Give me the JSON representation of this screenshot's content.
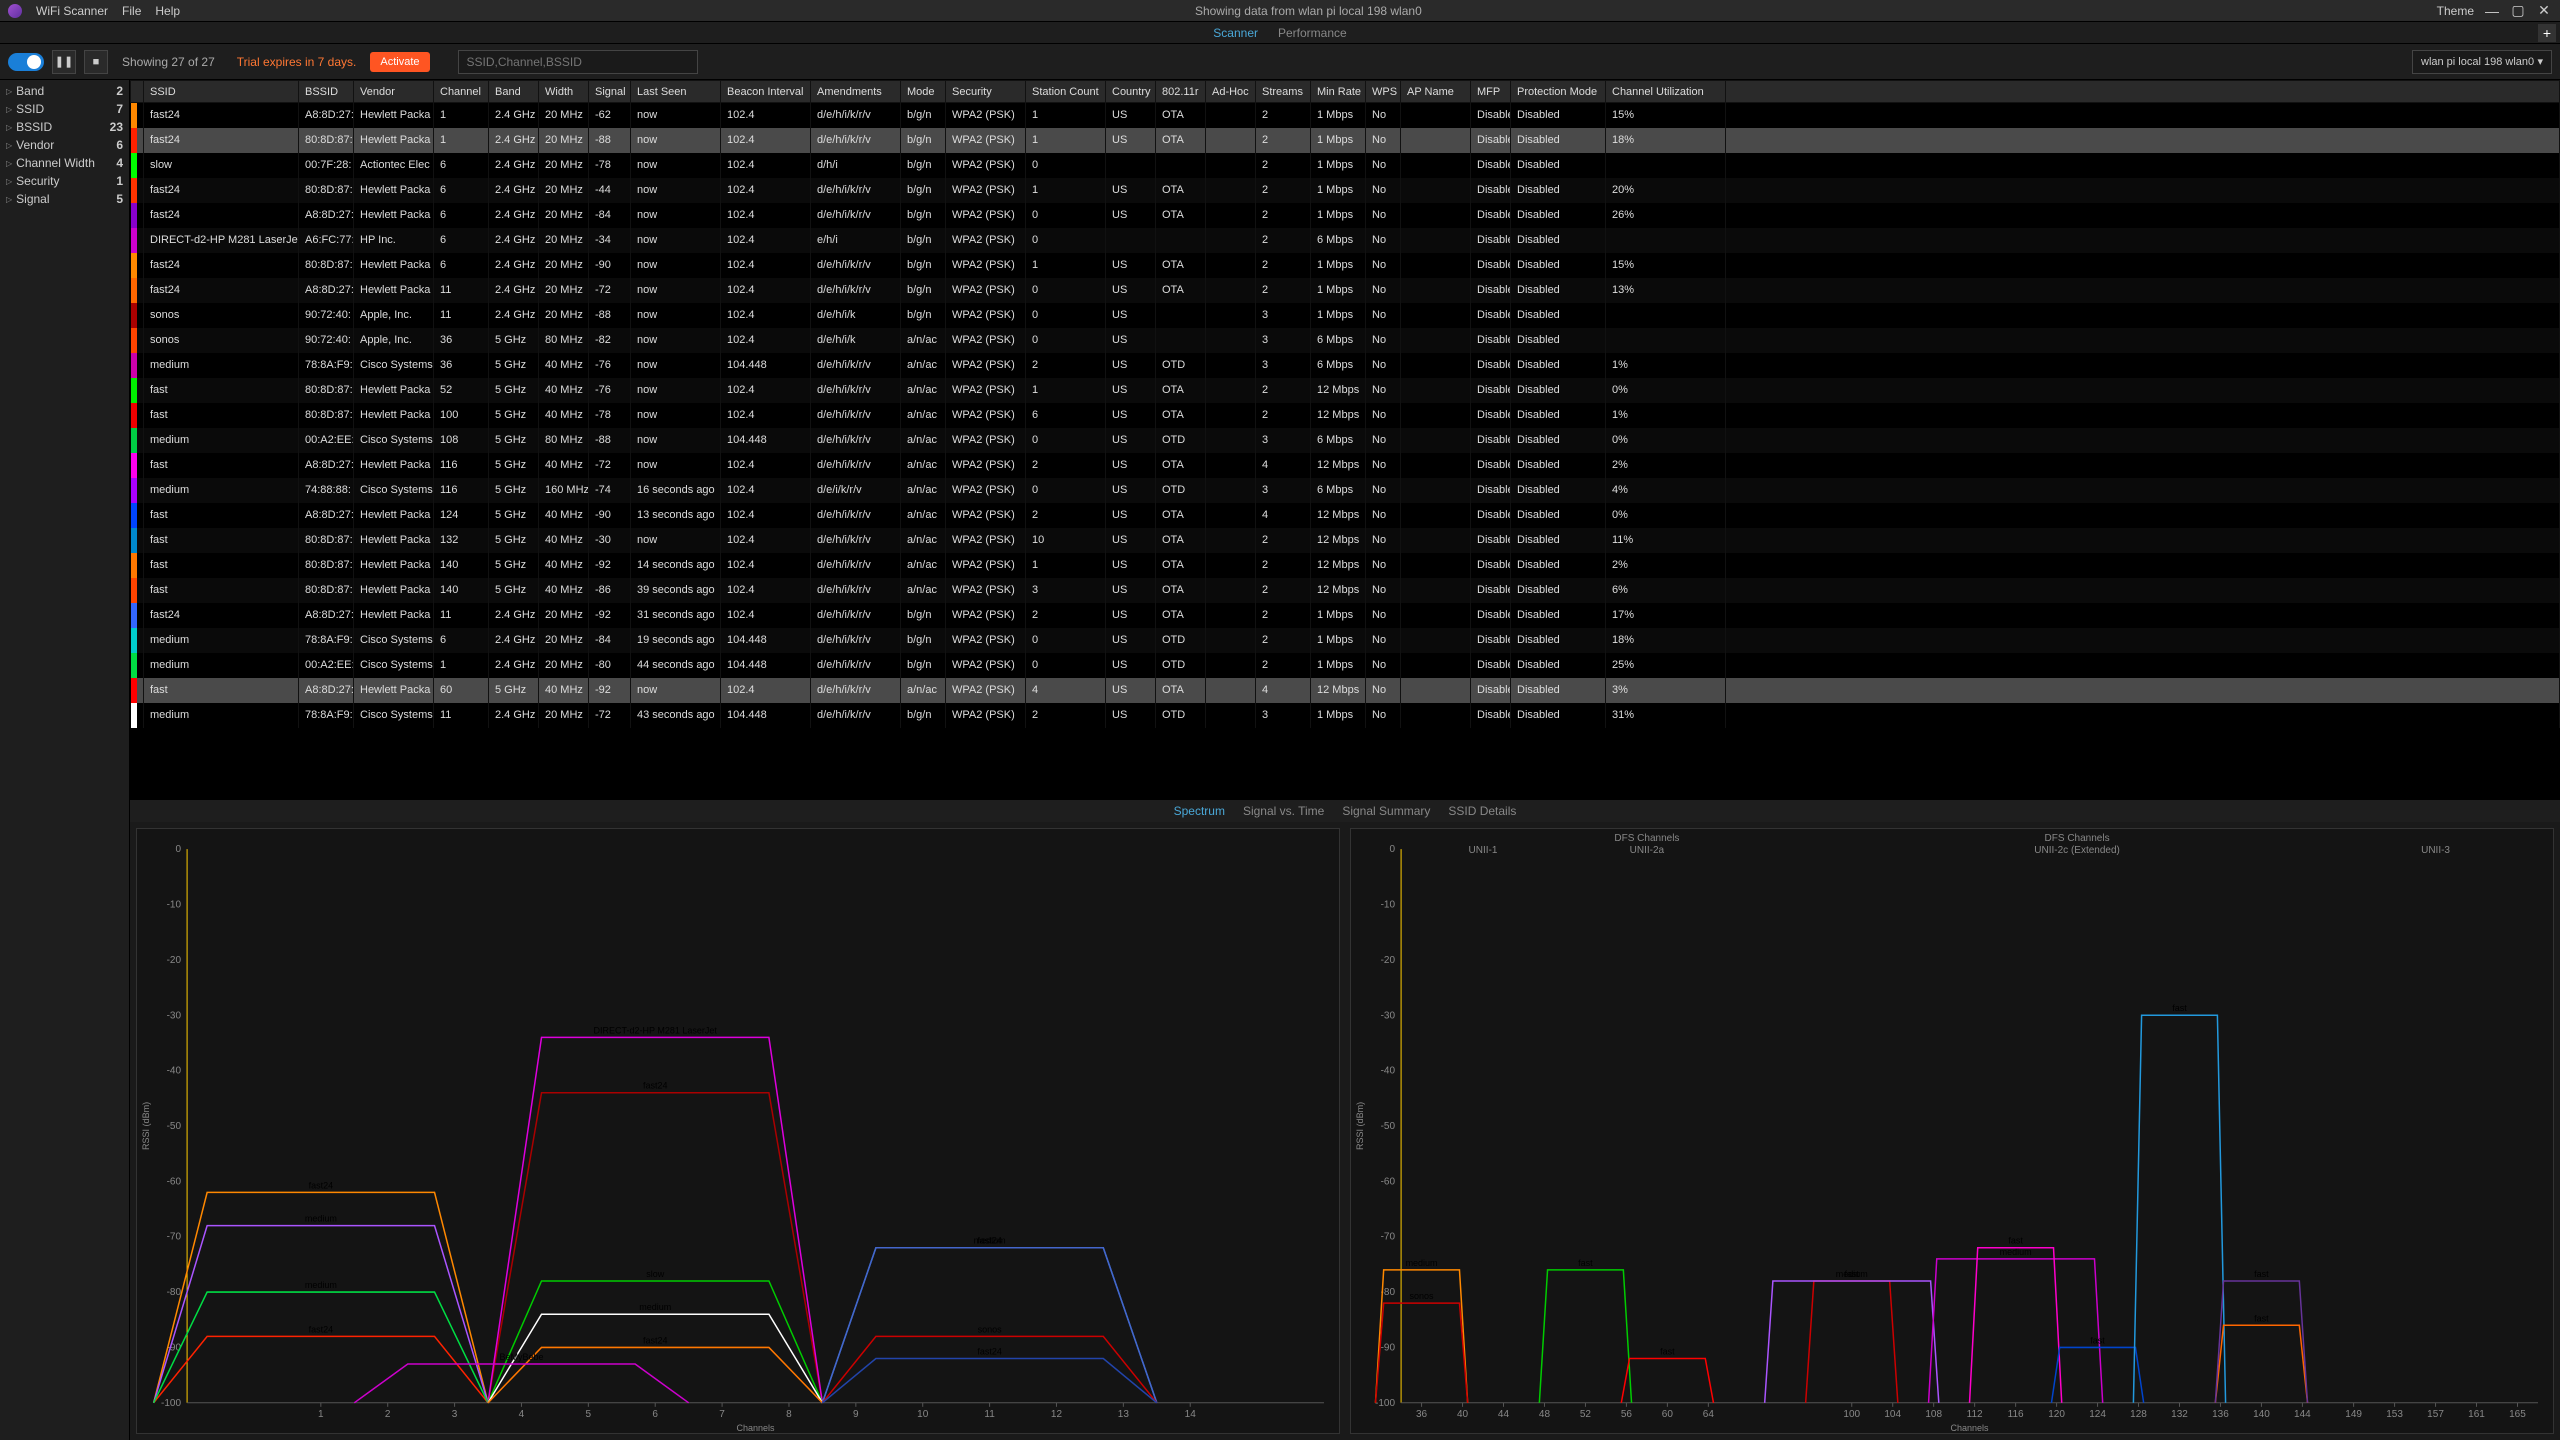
{
  "titlebar": {
    "app": "WiFi Scanner",
    "menu": [
      "File",
      "Help"
    ],
    "status": "Showing data from wlan pi local 198 wlan0",
    "theme": "Theme"
  },
  "subtabs": {
    "scanner": "Scanner",
    "performance": "Performance"
  },
  "toolbar": {
    "showing": "Showing 27 of 27",
    "trial": "Trial expires in 7 days.",
    "activate": "Activate",
    "search_placeholder": "SSID,Channel,BSSID",
    "iface": "wlan pi local 198 wlan0"
  },
  "filters": [
    {
      "label": "Band",
      "count": 2
    },
    {
      "label": "SSID",
      "count": 7
    },
    {
      "label": "BSSID",
      "count": 23
    },
    {
      "label": "Vendor",
      "count": 6
    },
    {
      "label": "Channel Width",
      "count": 4
    },
    {
      "label": "Security",
      "count": 1
    },
    {
      "label": "Signal",
      "count": 5
    }
  ],
  "columns": [
    "SSID",
    "BSSID",
    "Vendor",
    "Channel",
    "Band",
    "Width",
    "Signal",
    "Last Seen",
    "Beacon Interval",
    "Amendments",
    "Mode",
    "Security",
    "Station Count",
    "Country",
    "802.11r",
    "Ad-Hoc",
    "Streams",
    "Min Rate",
    "WPS",
    "AP Name",
    "MFP",
    "Protection Mode",
    "Channel Utilization"
  ],
  "rows": [
    {
      "c": "#ff8800",
      "sel": false,
      "d": [
        "fast24",
        "A8:8D:27:",
        "Hewlett Packa",
        "1",
        "2.4 GHz",
        "20 MHz",
        "-62",
        "now",
        "102.4",
        "d/e/h/i/k/r/v",
        "b/g/n",
        "WPA2 (PSK)",
        "1",
        "US",
        "OTA",
        "",
        "2",
        "1 Mbps",
        "No",
        "",
        "Disabled",
        "Disabled",
        "15%"
      ]
    },
    {
      "c": "#ff2200",
      "sel": true,
      "d": [
        "fast24",
        "80:8D:87:",
        "Hewlett Packa",
        "1",
        "2.4 GHz",
        "20 MHz",
        "-88",
        "now",
        "102.4",
        "d/e/h/i/k/r/v",
        "b/g/n",
        "WPA2 (PSK)",
        "1",
        "US",
        "OTA",
        "",
        "2",
        "1 Mbps",
        "No",
        "",
        "Disabled",
        "Disabled",
        "18%"
      ]
    },
    {
      "c": "#00ff00",
      "sel": false,
      "d": [
        "slow",
        "00:7F:28:",
        "Actiontec Elec",
        "6",
        "2.4 GHz",
        "20 MHz",
        "-78",
        "now",
        "102.4",
        "d/h/i",
        "b/g/n",
        "WPA2 (PSK)",
        "0",
        "",
        "",
        "",
        "2",
        "1 Mbps",
        "No",
        "",
        "Disabled",
        "Disabled",
        ""
      ]
    },
    {
      "c": "#ff3300",
      "sel": false,
      "d": [
        "fast24",
        "80:8D:87:",
        "Hewlett Packa",
        "6",
        "2.4 GHz",
        "20 MHz",
        "-44",
        "now",
        "102.4",
        "d/e/h/i/k/r/v",
        "b/g/n",
        "WPA2 (PSK)",
        "1",
        "US",
        "OTA",
        "",
        "2",
        "1 Mbps",
        "No",
        "",
        "Disabled",
        "Disabled",
        "20%"
      ]
    },
    {
      "c": "#8800cc",
      "sel": false,
      "d": [
        "fast24",
        "A8:8D:27:",
        "Hewlett Packa",
        "6",
        "2.4 GHz",
        "20 MHz",
        "-84",
        "now",
        "102.4",
        "d/e/h/i/k/r/v",
        "b/g/n",
        "WPA2 (PSK)",
        "0",
        "US",
        "OTA",
        "",
        "2",
        "1 Mbps",
        "No",
        "",
        "Disabled",
        "Disabled",
        "26%"
      ]
    },
    {
      "c": "#cc00cc",
      "sel": false,
      "d": [
        "DIRECT-d2-HP M281 LaserJet",
        "A6:FC:77:",
        "HP Inc.",
        "6",
        "2.4 GHz",
        "20 MHz",
        "-34",
        "now",
        "102.4",
        "e/h/i",
        "b/g/n",
        "WPA2 (PSK)",
        "0",
        "",
        "",
        "",
        "2",
        "6 Mbps",
        "No",
        "",
        "Disabled",
        "Disabled",
        ""
      ]
    },
    {
      "c": "#ff8800",
      "sel": false,
      "d": [
        "fast24",
        "80:8D:87:",
        "Hewlett Packa",
        "6",
        "2.4 GHz",
        "20 MHz",
        "-90",
        "now",
        "102.4",
        "d/e/h/i/k/r/v",
        "b/g/n",
        "WPA2 (PSK)",
        "1",
        "US",
        "OTA",
        "",
        "2",
        "1 Mbps",
        "No",
        "",
        "Disabled",
        "Disabled",
        "15%"
      ]
    },
    {
      "c": "#ff6600",
      "sel": false,
      "d": [
        "fast24",
        "A8:8D:27:",
        "Hewlett Packa",
        "11",
        "2.4 GHz",
        "20 MHz",
        "-72",
        "now",
        "102.4",
        "d/e/h/i/k/r/v",
        "b/g/n",
        "WPA2 (PSK)",
        "0",
        "US",
        "OTA",
        "",
        "2",
        "1 Mbps",
        "No",
        "",
        "Disabled",
        "Disabled",
        "13%"
      ]
    },
    {
      "c": "#aa0000",
      "sel": false,
      "d": [
        "sonos",
        "90:72:40:",
        "Apple, Inc.",
        "11",
        "2.4 GHz",
        "20 MHz",
        "-88",
        "now",
        "102.4",
        "d/e/h/i/k",
        "b/g/n",
        "WPA2 (PSK)",
        "0",
        "US",
        "",
        "",
        "3",
        "1 Mbps",
        "No",
        "",
        "Disabled",
        "Disabled",
        ""
      ]
    },
    {
      "c": "#ff4400",
      "sel": false,
      "d": [
        "sonos",
        "90:72:40:",
        "Apple, Inc.",
        "36",
        "5 GHz",
        "80 MHz",
        "-82",
        "now",
        "102.4",
        "d/e/h/i/k",
        "a/n/ac",
        "WPA2 (PSK)",
        "0",
        "US",
        "",
        "",
        "3",
        "6 Mbps",
        "No",
        "",
        "Disabled",
        "Disabled",
        ""
      ]
    },
    {
      "c": "#cc00aa",
      "sel": false,
      "d": [
        "medium",
        "78:8A:F9:",
        "Cisco Systems,",
        "36",
        "5 GHz",
        "40 MHz",
        "-76",
        "now",
        "104.448",
        "d/e/h/i/k/r/v",
        "a/n/ac",
        "WPA2 (PSK)",
        "2",
        "US",
        "OTD",
        "",
        "3",
        "6 Mbps",
        "No",
        "",
        "Disabled",
        "Disabled",
        "1%"
      ]
    },
    {
      "c": "#00ee00",
      "sel": false,
      "d": [
        "fast",
        "80:8D:87:",
        "Hewlett Packa",
        "52",
        "5 GHz",
        "40 MHz",
        "-76",
        "now",
        "102.4",
        "d/e/h/i/k/r/v",
        "a/n/ac",
        "WPA2 (PSK)",
        "1",
        "US",
        "OTA",
        "",
        "2",
        "12 Mbps",
        "No",
        "",
        "Disabled",
        "Disabled",
        "0%"
      ]
    },
    {
      "c": "#ee0000",
      "sel": false,
      "d": [
        "fast",
        "80:8D:87:",
        "Hewlett Packa",
        "100",
        "5 GHz",
        "40 MHz",
        "-78",
        "now",
        "102.4",
        "d/e/h/i/k/r/v",
        "a/n/ac",
        "WPA2 (PSK)",
        "6",
        "US",
        "OTA",
        "",
        "2",
        "12 Mbps",
        "No",
        "",
        "Disabled",
        "Disabled",
        "1%"
      ]
    },
    {
      "c": "#00cc44",
      "sel": false,
      "d": [
        "medium",
        "00:A2:EE:",
        "Cisco Systems,",
        "108",
        "5 GHz",
        "80 MHz",
        "-88",
        "now",
        "104.448",
        "d/e/h/i/k/r/v",
        "a/n/ac",
        "WPA2 (PSK)",
        "0",
        "US",
        "OTD",
        "",
        "3",
        "6 Mbps",
        "No",
        "",
        "Disabled",
        "Disabled",
        "0%"
      ]
    },
    {
      "c": "#ff00ee",
      "sel": false,
      "d": [
        "fast",
        "A8:8D:27:",
        "Hewlett Packa",
        "116",
        "5 GHz",
        "40 MHz",
        "-72",
        "now",
        "102.4",
        "d/e/h/i/k/r/v",
        "a/n/ac",
        "WPA2 (PSK)",
        "2",
        "US",
        "OTA",
        "",
        "4",
        "12 Mbps",
        "No",
        "",
        "Disabled",
        "Disabled",
        "2%"
      ]
    },
    {
      "c": "#aa00ff",
      "sel": false,
      "d": [
        "medium",
        "74:88:88:",
        "Cisco Systems,",
        "116",
        "5 GHz",
        "160 MHz",
        "-74",
        "16 seconds ago",
        "102.4",
        "d/e/i/k/r/v",
        "a/n/ac",
        "WPA2 (PSK)",
        "0",
        "US",
        "OTD",
        "",
        "3",
        "6 Mbps",
        "No",
        "",
        "Disabled",
        "Disabled",
        "4%"
      ]
    },
    {
      "c": "#0044ff",
      "sel": false,
      "d": [
        "fast",
        "A8:8D:27:",
        "Hewlett Packa",
        "124",
        "5 GHz",
        "40 MHz",
        "-90",
        "13 seconds ago",
        "102.4",
        "d/e/h/i/k/r/v",
        "a/n/ac",
        "WPA2 (PSK)",
        "2",
        "US",
        "OTA",
        "",
        "4",
        "12 Mbps",
        "No",
        "",
        "Disabled",
        "Disabled",
        "0%"
      ]
    },
    {
      "c": "#0088cc",
      "sel": false,
      "d": [
        "fast",
        "80:8D:87:",
        "Hewlett Packa",
        "132",
        "5 GHz",
        "40 MHz",
        "-30",
        "now",
        "102.4",
        "d/e/h/i/k/r/v",
        "a/n/ac",
        "WPA2 (PSK)",
        "10",
        "US",
        "OTA",
        "",
        "2",
        "12 Mbps",
        "No",
        "",
        "Disabled",
        "Disabled",
        "11%"
      ]
    },
    {
      "c": "#ff7700",
      "sel": false,
      "d": [
        "fast",
        "80:8D:87:",
        "Hewlett Packa",
        "140",
        "5 GHz",
        "40 MHz",
        "-92",
        "14 seconds ago",
        "102.4",
        "d/e/h/i/k/r/v",
        "a/n/ac",
        "WPA2 (PSK)",
        "1",
        "US",
        "OTA",
        "",
        "2",
        "12 Mbps",
        "No",
        "",
        "Disabled",
        "Disabled",
        "2%"
      ]
    },
    {
      "c": "#ff4400",
      "sel": false,
      "d": [
        "fast",
        "80:8D:87:",
        "Hewlett Packa",
        "140",
        "5 GHz",
        "40 MHz",
        "-86",
        "39 seconds ago",
        "102.4",
        "d/e/h/i/k/r/v",
        "a/n/ac",
        "WPA2 (PSK)",
        "3",
        "US",
        "OTA",
        "",
        "2",
        "12 Mbps",
        "No",
        "",
        "Disabled",
        "Disabled",
        "6%"
      ]
    },
    {
      "c": "#3366ff",
      "sel": false,
      "d": [
        "fast24",
        "A8:8D:27:",
        "Hewlett Packa",
        "11",
        "2.4 GHz",
        "20 MHz",
        "-92",
        "31 seconds ago",
        "102.4",
        "d/e/h/i/k/r/v",
        "b/g/n",
        "WPA2 (PSK)",
        "2",
        "US",
        "OTA",
        "",
        "2",
        "1 Mbps",
        "No",
        "",
        "Disabled",
        "Disabled",
        "17%"
      ]
    },
    {
      "c": "#00cccc",
      "sel": false,
      "d": [
        "medium",
        "78:8A:F9:",
        "Cisco Systems,",
        "6",
        "2.4 GHz",
        "20 MHz",
        "-84",
        "19 seconds ago",
        "104.448",
        "d/e/h/i/k/r/v",
        "b/g/n",
        "WPA2 (PSK)",
        "0",
        "US",
        "OTD",
        "",
        "2",
        "1 Mbps",
        "No",
        "",
        "Disabled",
        "Disabled",
        "18%"
      ]
    },
    {
      "c": "#00dd44",
      "sel": false,
      "d": [
        "medium",
        "00:A2:EE:",
        "Cisco Systems,",
        "1",
        "2.4 GHz",
        "20 MHz",
        "-80",
        "44 seconds ago",
        "104.448",
        "d/e/h/i/k/r/v",
        "b/g/n",
        "WPA2 (PSK)",
        "0",
        "US",
        "OTD",
        "",
        "2",
        "1 Mbps",
        "No",
        "",
        "Disabled",
        "Disabled",
        "25%"
      ]
    },
    {
      "c": "#ff0000",
      "sel": true,
      "d": [
        "fast",
        "A8:8D:27:",
        "Hewlett Packa",
        "60",
        "5 GHz",
        "40 MHz",
        "-92",
        "now",
        "102.4",
        "d/e/h/i/k/r/v",
        "a/n/ac",
        "WPA2 (PSK)",
        "4",
        "US",
        "OTA",
        "",
        "4",
        "12 Mbps",
        "No",
        "",
        "Disabled",
        "Disabled",
        "3%"
      ]
    },
    {
      "c": "#ffffff",
      "sel": false,
      "d": [
        "medium",
        "78:8A:F9:",
        "Cisco Systems,",
        "11",
        "2.4 GHz",
        "20 MHz",
        "-72",
        "43 seconds ago",
        "104.448",
        "d/e/h/i/k/r/v",
        "b/g/n",
        "WPA2 (PSK)",
        "2",
        "US",
        "OTD",
        "",
        "3",
        "1 Mbps",
        "No",
        "",
        "Disabled",
        "Disabled",
        "31%"
      ]
    }
  ],
  "bottomTabs": [
    "Spectrum",
    "Signal vs. Time",
    "Signal Summary",
    "SSID Details"
  ],
  "chart_data": [
    {
      "type": "spectrum",
      "xlabel": "Channels",
      "ylabel": "RSSI (dBm)",
      "ylim": [
        -100,
        0
      ],
      "xticks": [
        1,
        2,
        3,
        4,
        5,
        6,
        7,
        8,
        9,
        10,
        11,
        12,
        13,
        14
      ],
      "networks": [
        {
          "name": "fast24",
          "ch": 1,
          "width": 20,
          "rssi": -62,
          "color": "#ff8800"
        },
        {
          "name": "fast24",
          "ch": 1,
          "width": 20,
          "rssi": -88,
          "color": "#ff2200"
        },
        {
          "name": "medium",
          "ch": 1,
          "width": 20,
          "rssi": -68,
          "color": "#aa55ff"
        },
        {
          "name": "medium",
          "ch": 1,
          "width": 20,
          "rssi": -80,
          "color": "#00dd44"
        },
        {
          "name": "fast24",
          "ch": 6,
          "width": 20,
          "rssi": -44,
          "color": "#aa0000"
        },
        {
          "name": "DIRECT-d2-HP M281 LaserJet",
          "ch": 6,
          "width": 20,
          "rssi": -34,
          "color": "#dd00dd"
        },
        {
          "name": "slow",
          "ch": 6,
          "width": 20,
          "rssi": -78,
          "color": "#00cc00"
        },
        {
          "name": "medium",
          "ch": 6,
          "width": 20,
          "rssi": -84,
          "color": "#ffffff"
        },
        {
          "name": "fast24",
          "ch": 6,
          "width": 20,
          "rssi": -90,
          "color": "#ff7700"
        },
        {
          "name": "BeMyBebe",
          "ch": 4,
          "width": 20,
          "rssi": -93,
          "color": "#cc00cc"
        },
        {
          "name": "fast24",
          "ch": 11,
          "width": 20,
          "rssi": -72,
          "color": "#3388dd"
        },
        {
          "name": "medium",
          "ch": 11,
          "width": 20,
          "rssi": -72,
          "color": "#4466cc"
        },
        {
          "name": "sonos",
          "ch": 11,
          "width": 20,
          "rssi": -88,
          "color": "#cc0000"
        },
        {
          "name": "fast24",
          "ch": 11,
          "width": 20,
          "rssi": -92,
          "color": "#2244aa"
        }
      ]
    },
    {
      "type": "spectrum",
      "xlabel": "Channels",
      "ylabel": "RSSI (dBm)",
      "ylim": [
        -100,
        0
      ],
      "xticks": [
        36,
        40,
        44,
        48,
        52,
        56,
        60,
        64,
        100,
        104,
        108,
        112,
        116,
        120,
        124,
        128,
        132,
        136,
        140,
        144,
        149,
        153,
        157,
        161,
        165
      ],
      "bands": [
        {
          "label": "UNII-1",
          "sub": "",
          "start": 36,
          "end": 48
        },
        {
          "label": "DFS Channels",
          "sub": "UNII-2a",
          "start": 52,
          "end": 64
        },
        {
          "label": "DFS Channels",
          "sub": "UNII-2c (Extended)",
          "start": 100,
          "end": 144
        },
        {
          "label": "UNII-3",
          "sub": "",
          "start": 149,
          "end": 165
        }
      ],
      "networks": [
        {
          "name": "medium",
          "ch": 36,
          "width": 40,
          "rssi": -76,
          "color": "#ff8800"
        },
        {
          "name": "sonos",
          "ch": 36,
          "width": 40,
          "rssi": -82,
          "color": "#cc0000"
        },
        {
          "name": "fast",
          "ch": 52,
          "width": 40,
          "rssi": -76,
          "color": "#00cc00"
        },
        {
          "name": "fast",
          "ch": 60,
          "width": 40,
          "rssi": -92,
          "color": "#ff0000"
        },
        {
          "name": "fast",
          "ch": 100,
          "width": 40,
          "rssi": -78,
          "color": "#cc0000"
        },
        {
          "name": "medium",
          "ch": 100,
          "width": 80,
          "rssi": -78,
          "color": "#aa55ff"
        },
        {
          "name": "medium",
          "ch": 116,
          "width": 80,
          "rssi": -74,
          "color": "#cc00cc"
        },
        {
          "name": "fast",
          "ch": 116,
          "width": 40,
          "rssi": -72,
          "color": "#ff00cc"
        },
        {
          "name": "fast",
          "ch": 124,
          "width": 40,
          "rssi": -90,
          "color": "#0044cc"
        },
        {
          "name": "fast",
          "ch": 132,
          "width": 40,
          "rssi": -30,
          "color": "#2299dd"
        },
        {
          "name": "fast",
          "ch": 140,
          "width": 40,
          "rssi": -86,
          "color": "#ff6600"
        },
        {
          "name": "fast",
          "ch": 140,
          "width": 40,
          "rssi": -78,
          "color": "#663399"
        }
      ]
    }
  ]
}
